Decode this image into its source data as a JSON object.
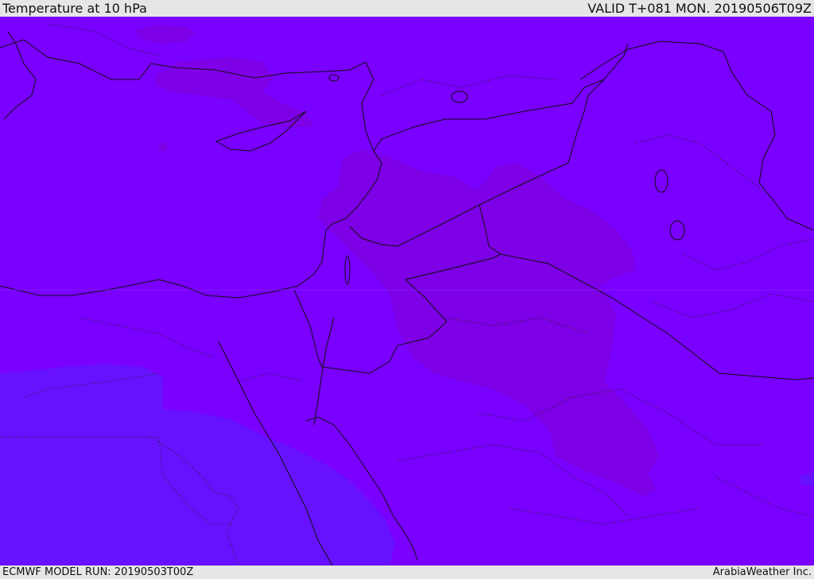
{
  "header": {
    "title": "Temperature at 10 hPa",
    "valid_time": "VALID T+081 MON. 20190506T09Z"
  },
  "footer": {
    "model_run": "ECMWF MODEL RUN: 20190503T00Z",
    "credit": "ArabiaWeather Inc."
  },
  "colors": {
    "background_field": "#7a00ff",
    "warm_patch": "#7d00e6",
    "cool_patch": "#6612ff",
    "border_line": "#111111"
  }
}
